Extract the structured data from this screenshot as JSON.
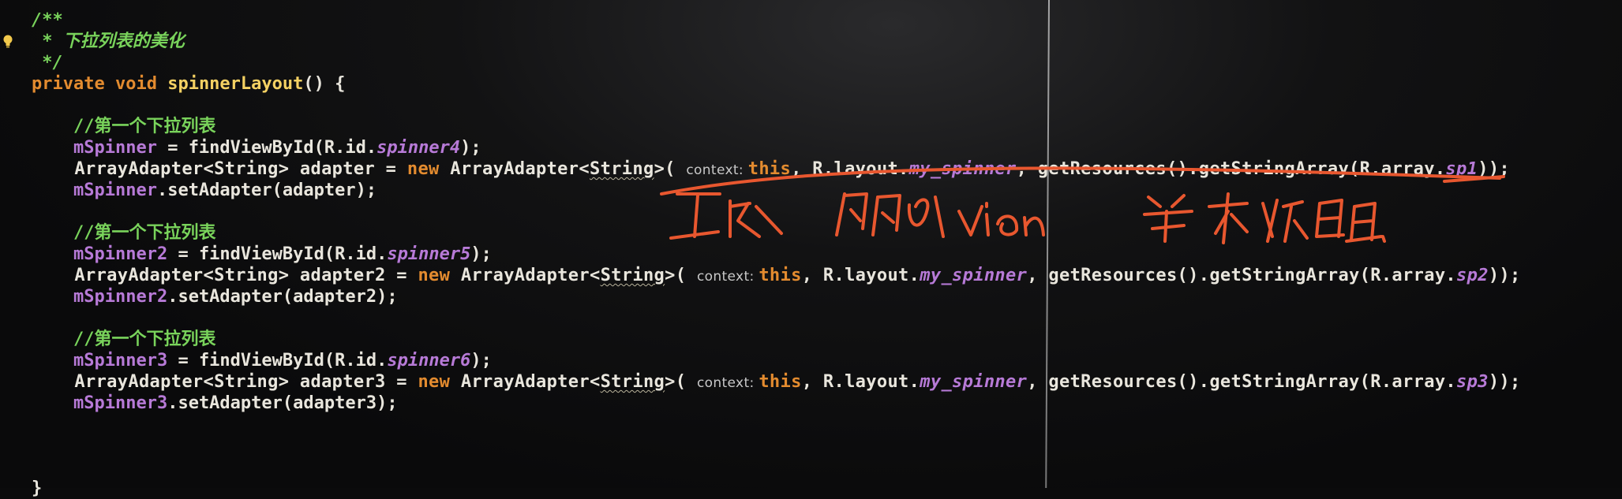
{
  "editor": {
    "code_lines": [
      {
        "segments": [
          {
            "t": "/**",
            "c": "doc"
          }
        ]
      },
      {
        "segments": [
          {
            "t": " * 下拉列表的美化",
            "c": "doc"
          }
        ]
      },
      {
        "segments": [
          {
            "t": " */",
            "c": "doc"
          }
        ]
      },
      {
        "segments": [
          {
            "t": "private ",
            "c": "kw"
          },
          {
            "t": "void ",
            "c": "kw"
          },
          {
            "t": "spinnerLayout",
            "c": "fn"
          },
          {
            "t": "() {",
            "c": ""
          }
        ]
      },
      {
        "segments": []
      },
      {
        "segments": [
          {
            "t": "    //第一个下拉列表",
            "c": "cmt"
          }
        ]
      },
      {
        "segments": [
          {
            "t": "    ",
            "c": ""
          },
          {
            "t": "mSpinner",
            "c": "fld"
          },
          {
            "t": " = findViewById(R.id.",
            "c": ""
          },
          {
            "t": "spinner4",
            "c": "fld ital"
          },
          {
            "t": ");",
            "c": ""
          }
        ]
      },
      {
        "segments": [
          {
            "t": "    ArrayAdapter<String> adapter = ",
            "c": ""
          },
          {
            "t": "new ",
            "c": "kw"
          },
          {
            "t": "ArrayAdapter<",
            "c": ""
          },
          {
            "t": "String",
            "c": "under"
          },
          {
            "t": ">( ",
            "c": ""
          },
          {
            "t": "context: ",
            "c": "hint"
          },
          {
            "t": "this",
            "c": "kw"
          },
          {
            "t": ", R.layout.",
            "c": ""
          },
          {
            "t": "my_spinner",
            "c": "fld ital"
          },
          {
            "t": ", getResources().getStringArray(R.array.",
            "c": ""
          },
          {
            "t": "sp1",
            "c": "fld ital"
          },
          {
            "t": "));",
            "c": ""
          }
        ]
      },
      {
        "segments": [
          {
            "t": "    ",
            "c": ""
          },
          {
            "t": "mSpinner",
            "c": "fld"
          },
          {
            "t": ".setAdapter(adapter);",
            "c": ""
          }
        ]
      },
      {
        "segments": []
      },
      {
        "segments": [
          {
            "t": "    //第一个下拉列表",
            "c": "cmt"
          }
        ]
      },
      {
        "segments": [
          {
            "t": "    ",
            "c": ""
          },
          {
            "t": "mSpinner2",
            "c": "fld"
          },
          {
            "t": " = findViewById(R.id.",
            "c": ""
          },
          {
            "t": "spinner5",
            "c": "fld ital"
          },
          {
            "t": ");",
            "c": ""
          }
        ]
      },
      {
        "segments": [
          {
            "t": "    ArrayAdapter<String> adapter2 = ",
            "c": ""
          },
          {
            "t": "new ",
            "c": "kw"
          },
          {
            "t": "ArrayAdapter<",
            "c": ""
          },
          {
            "t": "String",
            "c": "under"
          },
          {
            "t": ">( ",
            "c": ""
          },
          {
            "t": "context: ",
            "c": "hint"
          },
          {
            "t": "this",
            "c": "kw"
          },
          {
            "t": ", R.layout.",
            "c": ""
          },
          {
            "t": "my_spinner",
            "c": "fld ital"
          },
          {
            "t": ", getResources().getStringArray(R.array.",
            "c": ""
          },
          {
            "t": "sp2",
            "c": "fld ital"
          },
          {
            "t": "));",
            "c": ""
          }
        ]
      },
      {
        "segments": [
          {
            "t": "    ",
            "c": ""
          },
          {
            "t": "mSpinner2",
            "c": "fld"
          },
          {
            "t": ".setAdapter(adapter2);",
            "c": ""
          }
        ]
      },
      {
        "segments": []
      },
      {
        "segments": [
          {
            "t": "    //第一个下拉列表",
            "c": "cmt"
          }
        ]
      },
      {
        "segments": [
          {
            "t": "    ",
            "c": ""
          },
          {
            "t": "mSpinner3",
            "c": "fld"
          },
          {
            "t": " = findViewById(R.id.",
            "c": ""
          },
          {
            "t": "spinner6",
            "c": "fld ital"
          },
          {
            "t": ");",
            "c": ""
          }
        ]
      },
      {
        "segments": [
          {
            "t": "    ArrayAdapter<String> adapter3 = ",
            "c": ""
          },
          {
            "t": "new ",
            "c": "kw"
          },
          {
            "t": "ArrayAdapter<",
            "c": ""
          },
          {
            "t": "String",
            "c": "under"
          },
          {
            "t": ">( ",
            "c": ""
          },
          {
            "t": "context: ",
            "c": "hint"
          },
          {
            "t": "this",
            "c": "kw"
          },
          {
            "t": ", R.layout.",
            "c": ""
          },
          {
            "t": "my_spinner",
            "c": "fld ital"
          },
          {
            "t": ", getResources().getStringArray(R.array.",
            "c": ""
          },
          {
            "t": "sp3",
            "c": "fld ital"
          },
          {
            "t": "));",
            "c": ""
          }
        ]
      },
      {
        "segments": [
          {
            "t": "    ",
            "c": ""
          },
          {
            "t": "mSpinner3",
            "c": "fld"
          },
          {
            "t": ".setAdapter(adapter3);",
            "c": ""
          }
        ]
      },
      {
        "segments": []
      },
      {
        "segments": []
      },
      {
        "segments": []
      },
      {
        "segments": [
          {
            "t": "}",
            "c": ""
          }
        ]
      }
    ]
  },
  "annotation": {
    "handwritten_text": "上下文 一般的view 第一个数组",
    "ink_color": "#e8572f"
  },
  "gutter": {
    "icon": "lightbulb-icon",
    "icon_color": "#f2c94c"
  },
  "theme": {
    "background": "#0b0b0c",
    "keyword": "#e38b2f",
    "method_decl": "#f4d163",
    "field": "#b77ad7",
    "comment": "#79d35b",
    "text": "#e9e6dd"
  }
}
